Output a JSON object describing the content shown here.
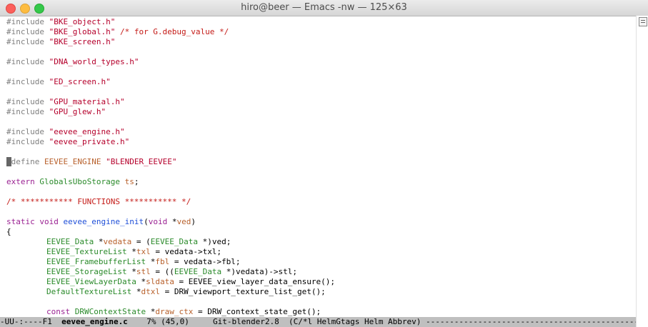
{
  "window": {
    "title": "hiro@beer — Emacs -nw — 125×63"
  },
  "colors": {
    "preprocessor": "#7f7f7f",
    "string": "#b5002b",
    "comment": "#c41a16",
    "keyword": "#9b2393",
    "type": "#2a8a2a",
    "function": "#1f4fd8",
    "variable": "#b8612c",
    "modeline_bg": "#bfbfbf"
  },
  "icons": {
    "scroll_thumb": "scroll-thumb-icon"
  },
  "code": {
    "l1": {
      "kw": "#include",
      "str": "\"BKE_object.h\""
    },
    "l2": {
      "kw": "#include",
      "str": "\"BKE_global.h\"",
      "comment": "/* for G.debug_value */"
    },
    "l3": {
      "kw": "#include",
      "str": "\"BKE_screen.h\""
    },
    "l4": {
      "kw": "#include",
      "str": "\"DNA_world_types.h\""
    },
    "l5": {
      "kw": "#include",
      "str": "\"ED_screen.h\""
    },
    "l6": {
      "kw": "#include",
      "str": "\"GPU_material.h\""
    },
    "l7": {
      "kw": "#include",
      "str": "\"GPU_glew.h\""
    },
    "l8": {
      "kw": "#include",
      "str": "\"eevee_engine.h\""
    },
    "l9": {
      "kw": "#include",
      "str": "\"eevee_private.h\""
    },
    "l10": {
      "cursor": "#",
      "kw": "define",
      "name": "EEVEE_ENGINE",
      "str": "\"BLENDER_EEVEE\""
    },
    "l11": {
      "kw": "extern",
      "type": "GlobalsUboStorage",
      "var": "ts",
      "punct": ";"
    },
    "l12": {
      "comment": "/* *********** FUNCTIONS *********** */"
    },
    "l13": {
      "kw": "static",
      "type": "void",
      "fn": "eevee_engine_init",
      "args_open": "(",
      "argtype": "void",
      "star": " *",
      "var": "ved",
      "args_close": ")"
    },
    "l14": {
      "text": "{"
    },
    "l15": {
      "type": "EEVEE_Data",
      "star": " *",
      "var": "vedata",
      "mid": " = (",
      "type2": "EEVEE_Data",
      "rest": " *)ved;"
    },
    "l16": {
      "type": "EEVEE_TextureList",
      "star": " *",
      "var": "txl",
      "rest": " = vedata->txl;"
    },
    "l17": {
      "type": "EEVEE_FramebufferList",
      "star": " *",
      "var": "fbl",
      "rest": " = vedata->fbl;"
    },
    "l18": {
      "type": "EEVEE_StorageList",
      "star": " *",
      "var": "stl",
      "mid": " = ((",
      "type2": "EEVEE_Data",
      "rest": " *)vedata)->stl;"
    },
    "l19": {
      "type": "EEVEE_ViewLayerData",
      "star": " *",
      "var": "sldata",
      "rest": " = EEVEE_view_layer_data_ensure();"
    },
    "l20": {
      "type": "DefaultTextureList",
      "star": " *",
      "var": "dtxl",
      "rest": " = DRW_viewport_texture_list_get();"
    },
    "l21": {
      "kw": "const",
      "type": "DRWContextState",
      "star": " *",
      "var": "draw_ctx",
      "rest": " = DRW_context_state_get();"
    }
  },
  "modeline": {
    "prefix": "-UU-:----F1  ",
    "buffer": "eevee_engine.c",
    "position": "    7% (45,0)     Git-blender2.8  (C/*l HelmGtags Helm Abbrev) ",
    "fill": "----------------------------------------------"
  }
}
